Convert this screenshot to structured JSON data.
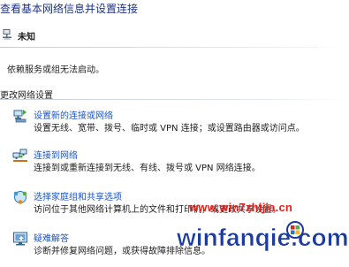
{
  "page": {
    "title": "查看基本网络信息并设置连接"
  },
  "network": {
    "name": "未知",
    "message": "依赖服务或组无法启动。"
  },
  "section": {
    "header": "更改网络设置"
  },
  "tasks": [
    {
      "link": "设置新的连接或网络",
      "description": "设置无线、宽带、拨号、临时或 VPN 连接；或设置路由器或访问点。",
      "icon": "network-setup-icon"
    },
    {
      "link": "连接到网络",
      "description": "连接到或重新连接到无线、有线、拨号或 VPN 网络连接。",
      "icon": "connect-network-icon"
    },
    {
      "link": "选择家庭组和共享选项",
      "description": "访问位于其他网络计算机上的文件和打印机，或更改共享设置。",
      "icon": "homegroup-icon"
    },
    {
      "link": "疑难解答",
      "description": "诊断并修复网络问题，或获得故障排除信息。",
      "icon": "troubleshoot-icon"
    }
  ],
  "watermark": {
    "url": "www.win7zhijia.cn",
    "logo_text": "winfanqie.com"
  },
  "colors": {
    "link": "#1a55c8",
    "title": "#1e3287",
    "watermark_red": "#e0231c",
    "watermark_blue": "#1b3c9e"
  }
}
